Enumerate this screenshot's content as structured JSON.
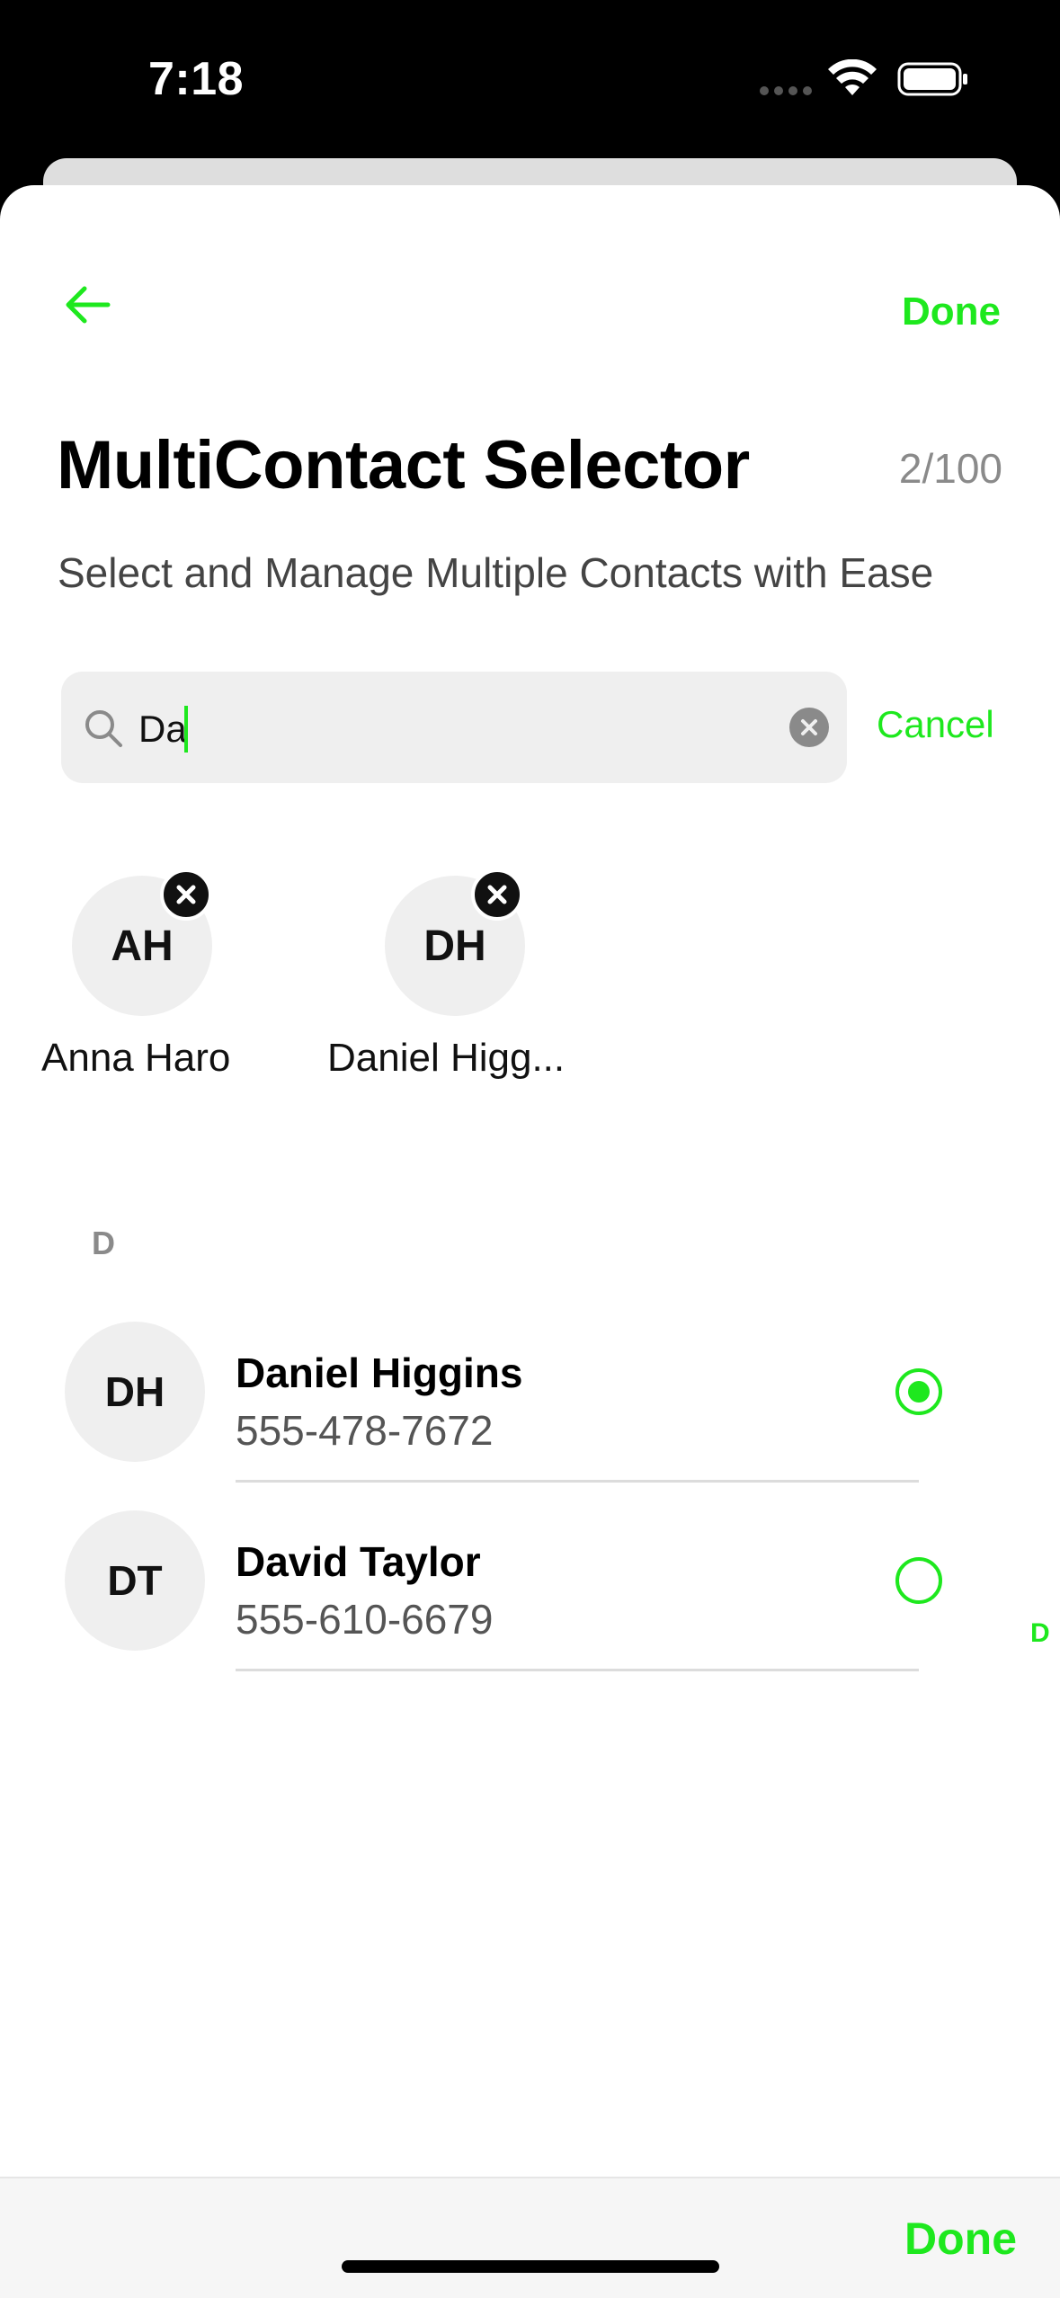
{
  "status_bar": {
    "time": "7:18"
  },
  "header": {
    "back_icon": "arrow-left-icon",
    "done_label": "Done"
  },
  "title": "MultiContact Selector",
  "counter": "2/100",
  "subtitle": "Select and Manage Multiple Contacts with Ease",
  "search": {
    "value": "Da",
    "cancel_label": "Cancel"
  },
  "selected_chips": [
    {
      "initials": "AH",
      "name": "Anna Haro"
    },
    {
      "initials": "DH",
      "name": "Daniel Higg..."
    }
  ],
  "section": {
    "letter": "D"
  },
  "contacts": [
    {
      "initials": "DH",
      "name": "Daniel Higgins",
      "phone": "555-478-7672",
      "selected": true
    },
    {
      "initials": "DT",
      "name": "David Taylor",
      "phone": "555-610-6679",
      "selected": false
    }
  ],
  "index_letters": [
    "D"
  ],
  "footer": {
    "done_label": "Done"
  },
  "colors": {
    "accent": "#1EE81E",
    "avatar_bg": "#EFEFEF",
    "search_bg": "#EFEFEF"
  }
}
